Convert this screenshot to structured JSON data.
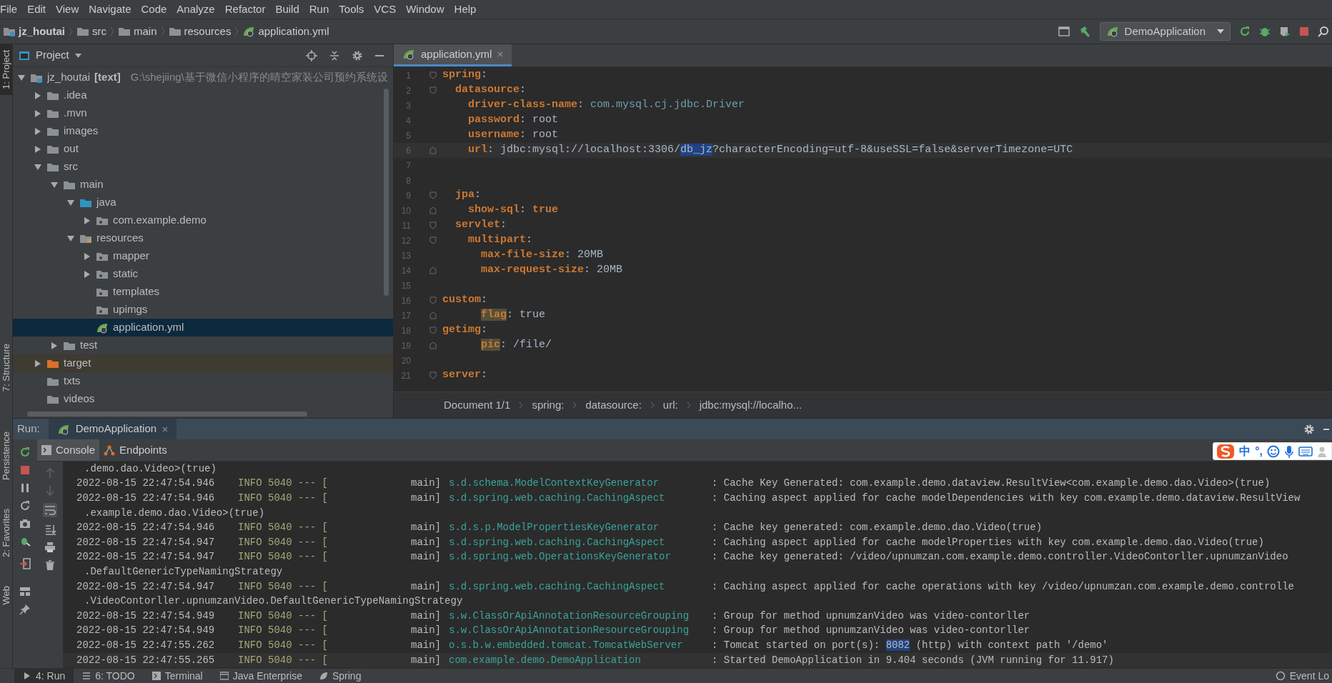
{
  "menu": [
    "File",
    "Edit",
    "View",
    "Navigate",
    "Code",
    "Analyze",
    "Refactor",
    "Build",
    "Run",
    "Tools",
    "VCS",
    "Window",
    "Help"
  ],
  "nav_path": [
    {
      "label": "jz_houtai",
      "kind": "module"
    },
    {
      "label": "src",
      "kind": "folder"
    },
    {
      "label": "main",
      "kind": "folder"
    },
    {
      "label": "resources",
      "kind": "folder"
    },
    {
      "label": "application.yml",
      "kind": "spring"
    }
  ],
  "run_config": "DemoApplication",
  "side_tabs_top": [
    {
      "label": "1: Project",
      "selected": true
    }
  ],
  "side_tabs_middle": [
    {
      "label": "7: Structure",
      "selected": false
    }
  ],
  "side_tabs_bottom": [
    {
      "label": "Persistence",
      "selected": false
    },
    {
      "label": "2: Favorites",
      "selected": false
    },
    {
      "label": "Web",
      "selected": false
    }
  ],
  "project": {
    "title": "Project",
    "tree": [
      {
        "label": "jz_houtai",
        "tag": "[text]",
        "path": "G:\\shejiing\\基于微信小程序的晴空家装公司预约系统设",
        "kind": "module",
        "expanded": true,
        "selected": false,
        "children": [
          {
            "label": ".idea",
            "kind": "folder",
            "expanded": false,
            "selected": false
          },
          {
            "label": ".mvn",
            "kind": "folder",
            "expanded": false,
            "selected": false
          },
          {
            "label": "images",
            "kind": "folder",
            "expanded": false,
            "selected": false
          },
          {
            "label": "out",
            "kind": "folder",
            "expanded": false,
            "selected": false
          },
          {
            "label": "src",
            "kind": "folder",
            "expanded": true,
            "selected": false,
            "children": [
              {
                "label": "main",
                "kind": "folder",
                "expanded": true,
                "selected": false,
                "children": [
                  {
                    "label": "java",
                    "kind": "source",
                    "expanded": true,
                    "selected": false,
                    "children": [
                      {
                        "label": "com.example.demo",
                        "kind": "package",
                        "expanded": false,
                        "selected": false
                      }
                    ]
                  },
                  {
                    "label": "resources",
                    "kind": "resources",
                    "expanded": true,
                    "selected": false,
                    "children": [
                      {
                        "label": "mapper",
                        "kind": "package",
                        "expanded": false,
                        "selected": false
                      },
                      {
                        "label": "static",
                        "kind": "package",
                        "expanded": false,
                        "selected": false
                      },
                      {
                        "label": "templates",
                        "kind": "package",
                        "selected": false
                      },
                      {
                        "label": "upimgs",
                        "kind": "package",
                        "selected": false
                      },
                      {
                        "label": "application.yml",
                        "kind": "spring",
                        "selected": true
                      }
                    ]
                  }
                ]
              },
              {
                "label": "test",
                "kind": "folder",
                "expanded": false,
                "selected": false
              }
            ]
          },
          {
            "label": "target",
            "kind": "excluded",
            "expanded": false,
            "selected": false
          },
          {
            "label": "txts",
            "kind": "folder",
            "selected": false
          },
          {
            "label": "videos",
            "kind": "folder",
            "selected": false
          }
        ]
      }
    ]
  },
  "editor": {
    "tab": "application.yml",
    "lines": [
      {
        "n": "1",
        "fold_start": true,
        "seg": [
          {
            "t": "spring",
            "kind": "key"
          },
          {
            "t": ":",
            "kind": "text"
          }
        ]
      },
      {
        "n": "2",
        "fold_start": true,
        "seg": [
          {
            "t": "  datasource",
            "kind": "key"
          },
          {
            "t": ":",
            "kind": "text"
          }
        ]
      },
      {
        "n": "3",
        "seg": [
          {
            "t": "    driver-class-name",
            "kind": "key"
          },
          {
            "t": ": ",
            "kind": "text"
          },
          {
            "t": "com.mysql.cj.jdbc.Driver",
            "kind": "class"
          }
        ]
      },
      {
        "n": "4",
        "seg": [
          {
            "t": "    password",
            "kind": "key"
          },
          {
            "t": ": root",
            "kind": "text"
          }
        ]
      },
      {
        "n": "5",
        "seg": [
          {
            "t": "    username",
            "kind": "key"
          },
          {
            "t": ": root",
            "kind": "text"
          }
        ]
      },
      {
        "n": "6",
        "fold_end": true,
        "current": true,
        "seg": [
          {
            "t": "    url",
            "kind": "key"
          },
          {
            "t": ": jdbc:mysql://localhost:3306/",
            "kind": "text"
          },
          {
            "t": "db_jz",
            "kind": "sel"
          },
          {
            "t": "?characterEncoding=utf-8&useSSL=false&serverTimezone=UTC",
            "kind": "text"
          }
        ]
      },
      {
        "n": "7"
      },
      {
        "n": "8"
      },
      {
        "n": "9",
        "fold_start": true,
        "seg": [
          {
            "t": "  jpa",
            "kind": "key"
          },
          {
            "t": ":",
            "kind": "text"
          }
        ]
      },
      {
        "n": "10",
        "fold_end": true,
        "seg": [
          {
            "t": "    show-sql",
            "kind": "key"
          },
          {
            "t": ": ",
            "kind": "text"
          },
          {
            "t": "true",
            "kind": "bool"
          }
        ]
      },
      {
        "n": "11",
        "fold_start": true,
        "seg": [
          {
            "t": "  servlet",
            "kind": "key"
          },
          {
            "t": ":",
            "kind": "text"
          }
        ]
      },
      {
        "n": "12",
        "fold_start": true,
        "seg": [
          {
            "t": "    multipart",
            "kind": "key"
          },
          {
            "t": ":",
            "kind": "text"
          }
        ]
      },
      {
        "n": "13",
        "seg": [
          {
            "t": "      max-file-size",
            "kind": "key"
          },
          {
            "t": ": 20MB",
            "kind": "text"
          }
        ]
      },
      {
        "n": "14",
        "fold_end": true,
        "seg": [
          {
            "t": "      max-request-size",
            "kind": "key"
          },
          {
            "t": ": 20MB",
            "kind": "text"
          }
        ]
      },
      {
        "n": "15"
      },
      {
        "n": "16",
        "fold_start": true,
        "seg": [
          {
            "t": "custom",
            "kind": "key"
          },
          {
            "t": ":",
            "kind": "text"
          }
        ]
      },
      {
        "n": "17",
        "fold_end": true,
        "nested": true,
        "seg": [
          {
            "t": "flag",
            "kind": "mark"
          },
          {
            "t": ": true",
            "kind": "text"
          }
        ]
      },
      {
        "n": "18",
        "fold_start": true,
        "seg": [
          {
            "t": "getimg",
            "kind": "key"
          },
          {
            "t": ":",
            "kind": "text"
          }
        ]
      },
      {
        "n": "19",
        "fold_end": true,
        "nested": true,
        "seg": [
          {
            "t": "pic",
            "kind": "mark"
          },
          {
            "t": ": /file/",
            "kind": "text"
          }
        ]
      },
      {
        "n": "20"
      },
      {
        "n": "21",
        "fold_start": true,
        "seg": [
          {
            "t": "server",
            "kind": "key"
          },
          {
            "t": ":",
            "kind": "text"
          }
        ]
      }
    ],
    "breadcrumb": [
      "Document 1/1",
      "spring:",
      "datasource:",
      "url:",
      "jdbc:mysql://localho..."
    ]
  },
  "run": {
    "title": "Run:",
    "tab": "DemoApplication",
    "subtabs": [
      {
        "label": "Console",
        "kind": "console",
        "selected": true
      },
      {
        "label": "Endpoints",
        "kind": "endpoints",
        "selected": false
      }
    ],
    "lines": [
      {
        "kind": "cont",
        "text": ".demo.dao.Video>(true)"
      },
      {
        "kind": "log",
        "time": "2022-08-15 22:47:54.946",
        "level": "INFO 5040 --- [",
        "thread": "main]",
        "logger": "s.d.schema.ModelContextKeyGenerator",
        "message": ": Cache Key Generated: com.example.demo.dataview.ResultView<com.example.demo.dao.Video>(true)"
      },
      {
        "kind": "log",
        "time": "2022-08-15 22:47:54.946",
        "level": "INFO 5040 --- [",
        "thread": "main]",
        "logger": "s.d.spring.web.caching.CachingAspect",
        "message": ": Caching aspect applied for cache modelDependencies with key com.example.demo.dataview.ResultView"
      },
      {
        "kind": "cont",
        "text": ".example.demo.dao.Video>(true)"
      },
      {
        "kind": "log",
        "time": "2022-08-15 22:47:54.946",
        "level": "INFO 5040 --- [",
        "thread": "main]",
        "logger": "s.d.s.p.ModelPropertiesKeyGenerator",
        "message": ": Cache key generated: com.example.demo.dao.Video(true)"
      },
      {
        "kind": "log",
        "time": "2022-08-15 22:47:54.947",
        "level": "INFO 5040 --- [",
        "thread": "main]",
        "logger": "s.d.spring.web.caching.CachingAspect",
        "message": ": Caching aspect applied for cache modelProperties with key com.example.demo.dao.Video(true)"
      },
      {
        "kind": "log",
        "time": "2022-08-15 22:47:54.947",
        "level": "INFO 5040 --- [",
        "thread": "main]",
        "logger": "s.d.spring.web.OperationsKeyGenerator",
        "message": ": Cache key generated: /video/upnumzan.com.example.demo.controller.VideoContorller.upnumzanVideo"
      },
      {
        "kind": "cont",
        "text": ".DefaultGenericTypeNamingStrategy"
      },
      {
        "kind": "log",
        "time": "2022-08-15 22:47:54.947",
        "level": "INFO 5040 --- [",
        "thread": "main]",
        "logger": "s.d.spring.web.caching.CachingAspect",
        "message": ": Caching aspect applied for cache operations with key /video/upnumzan.com.example.demo.controlle"
      },
      {
        "kind": "cont",
        "text": ".VideoContorller.upnumzanVideo.DefaultGenericTypeNamingStrategy"
      },
      {
        "kind": "log",
        "time": "2022-08-15 22:47:54.949",
        "level": "INFO 5040 --- [",
        "thread": "main]",
        "logger": "s.w.ClassOrApiAnnotationResourceGrouping",
        "message": ": Group for method upnumzanVideo was video-contorller"
      },
      {
        "kind": "log",
        "time": "2022-08-15 22:47:54.949",
        "level": "INFO 5040 --- [",
        "thread": "main]",
        "logger": "s.w.ClassOrApiAnnotationResourceGrouping",
        "message": ": Group for method upnumzanVideo was video-contorller"
      },
      {
        "kind": "log",
        "time": "2022-08-15 22:47:55.262",
        "level": "INFO 5040 --- [",
        "thread": "main]",
        "logger": "o.s.b.w.embedded.tomcat.TomcatWebServer",
        "message": ": Tomcat started on port(s): ",
        "selected_text": "8082",
        "message_end": " (http) with context path '/demo'"
      },
      {
        "kind": "log",
        "current": true,
        "time": "2022-08-15 22:47:55.265",
        "level": "INFO 5040 --- [",
        "thread": "main]",
        "logger": "com.example.demo.DemoApplication",
        "message": ": Started DemoApplication in 9.404 seconds (JVM running for 11.917)"
      }
    ]
  },
  "ime": {
    "lang": "中",
    "punct": "°,"
  },
  "bottom_tabs": [
    {
      "label": "4: Run",
      "kind": "run",
      "selected": true
    },
    {
      "label": "6: TODO",
      "kind": "todo",
      "selected": false
    },
    {
      "label": "Terminal",
      "kind": "terminal",
      "selected": false
    },
    {
      "label": "Java Enterprise",
      "kind": "java",
      "selected": false
    },
    {
      "label": "Spring",
      "kind": "spring",
      "selected": false
    }
  ],
  "event_log": "Event Lo"
}
